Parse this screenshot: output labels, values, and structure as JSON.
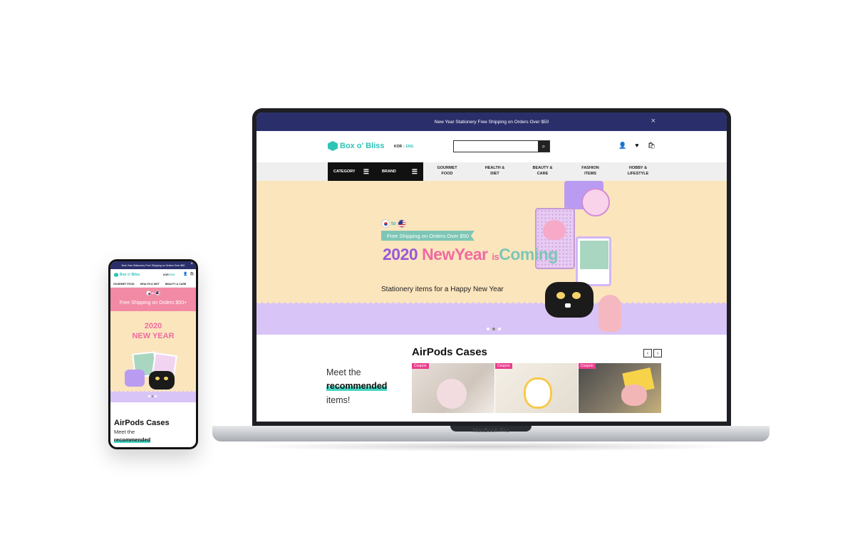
{
  "desktop": {
    "announcement": "New Year Stationery Free Shipping on Orders Over $50",
    "close_icon": "×",
    "logo": "Box o' Bliss",
    "lang": {
      "kor": "KOR",
      "eng": "ENG"
    },
    "search_placeholder": "",
    "search_icon": "⌕",
    "icons": {
      "user": "👤",
      "heart": "♥",
      "cart": "🛍"
    },
    "category_label": "CATEGORY",
    "brand_label": "BRAND",
    "menu_icon": "☰",
    "menu": [
      "GOURMET\nFOOD",
      "HEALTH &\nDIET",
      "BEAUTY &\nCARE",
      "FASHION\nITEMS",
      "HOBBY &\nLIFESTYLE"
    ],
    "hero": {
      "to": "to",
      "ship_badge": "Free Shipping on Orders Over $50",
      "year": "2020",
      "new_year": "NewYear",
      "is": "is",
      "coming": "Coming",
      "sub": "Stationery items for a Happy New Year",
      "slides": 3,
      "active_slide": 2
    },
    "section": {
      "title": "AirPods Cases",
      "meet_line1": "Meet the",
      "meet_highlight": "recommended",
      "meet_line3": "items!",
      "prev": "‹",
      "next": "›",
      "coupon": "Coupon"
    },
    "device_label": "MacBook Pro"
  },
  "mobile": {
    "announcement": "New Year Stationery Free Shipping on Orders Over $50",
    "close_icon": "×",
    "logo": "Box o' Bliss",
    "lang": {
      "kor": "KOR",
      "eng": "ENG"
    },
    "menu": [
      "GOURMET FOOD",
      "HEALTH & DIET",
      "BEAUTY & CARE"
    ],
    "to": "to",
    "ship_text": "Free Shipping on Orders $50+",
    "year_line1": "2020",
    "year_line2": "NEW YEAR",
    "title": "AirPods Cases",
    "meet_line1": "Meet the",
    "meet_highlight": "recommended"
  }
}
